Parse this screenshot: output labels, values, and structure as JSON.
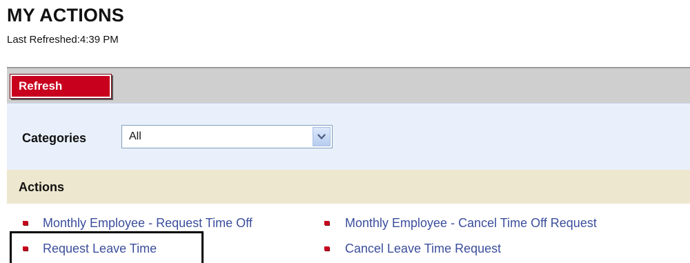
{
  "header": {
    "title": "MY ACTIONS",
    "last_refreshed": "Last Refreshed:4:39 PM"
  },
  "toolbar": {
    "refresh_label": "Refresh"
  },
  "categories": {
    "label": "Categories",
    "selected": "All"
  },
  "actions": {
    "title": "Actions",
    "items": [
      {
        "label": "Monthly Employee - Request Time Off"
      },
      {
        "label": "Monthly Employee - Cancel Time Off Request"
      },
      {
        "label": "Request Leave Time"
      },
      {
        "label": "Cancel Leave Time Request"
      }
    ]
  },
  "colors": {
    "accent_red": "#c8001e",
    "link_blue": "#3b4e9c",
    "toolbar_gray": "#cfcfcf",
    "categories_bg": "#e9f0fb",
    "actions_header_bg": "#eee7cf"
  },
  "icons": {
    "select_arrow": "chevron-down-icon",
    "bullet": "square-bullet-icon"
  }
}
